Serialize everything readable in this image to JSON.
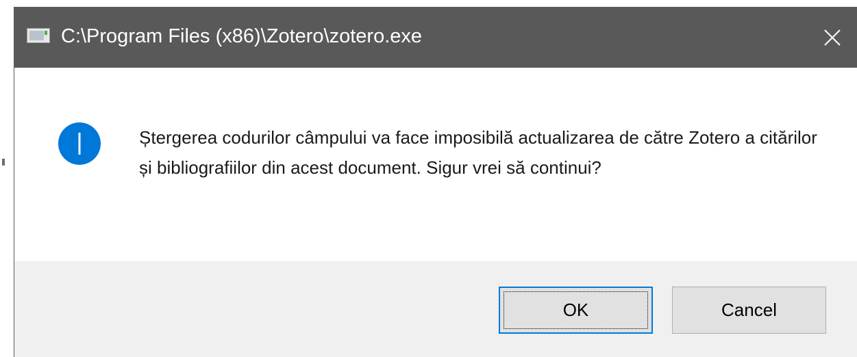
{
  "window": {
    "title": "C:\\Program Files (x86)\\Zotero\\zotero.exe",
    "icon": "app-window-icon",
    "close_icon": "close-icon"
  },
  "dialog": {
    "icon": "info-icon",
    "message": "Ștergerea codurilor câmpului va face imposibilă actualizarea de către Zotero a citărilor și bibliografiilor din acest document. Sigur vrei să continui?"
  },
  "buttons": {
    "ok_label": "OK",
    "cancel_label": "Cancel"
  },
  "colors": {
    "titlebar": "#595959",
    "info_icon": "#0078d7",
    "footer": "#f0f0f0",
    "focused_border": "#0078d7"
  }
}
